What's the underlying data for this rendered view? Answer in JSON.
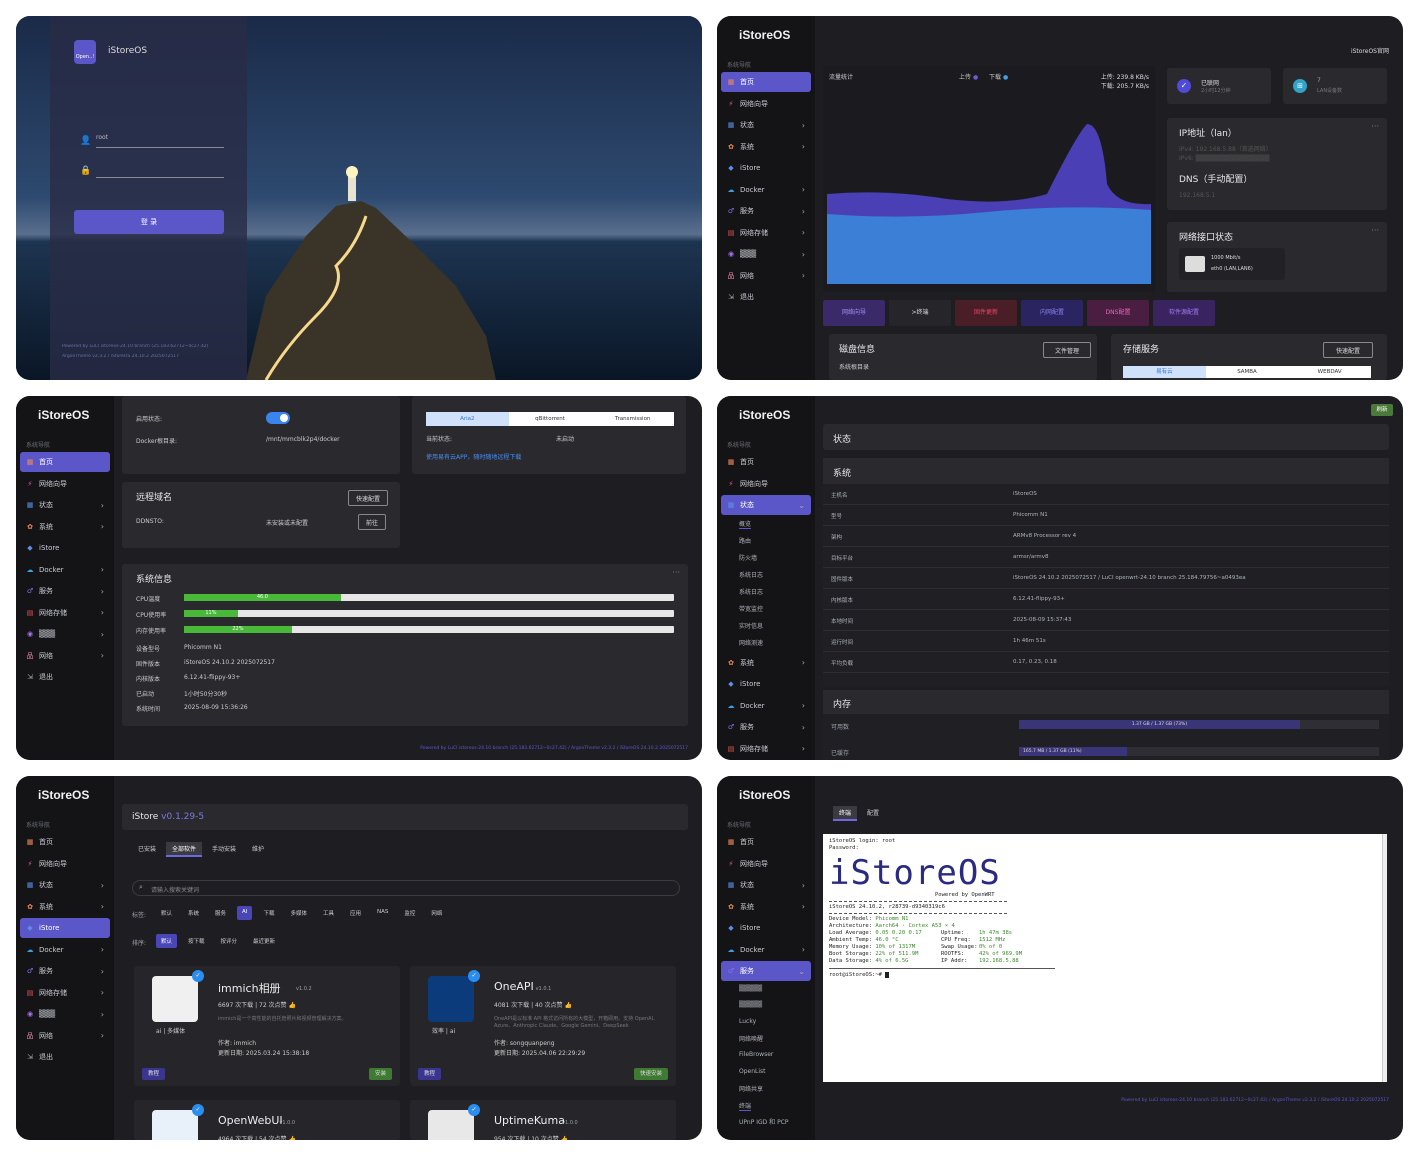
{
  "login": {
    "brand": "iStoreOS",
    "brand_badge": "Open..!",
    "username": "root",
    "login_button": "登 录",
    "footer_line1": "Powered by LuCI istoreos-24.10 branch (25.183.62712~0c27.42)",
    "footer_line2": "ArgonTheme v2.3.2 / iStoreOS 24.10.2 2025072517"
  },
  "sidebar": {
    "logo": "iStoreOS",
    "header": "系统导航",
    "items": [
      {
        "icon": "home-icon",
        "glyph": "▦",
        "label": "首页",
        "arrow": ""
      },
      {
        "icon": "wizard-icon",
        "glyph": "⚡",
        "label": "网络向导",
        "arrow": ""
      },
      {
        "icon": "status-icon",
        "glyph": "▦",
        "label": "状态",
        "arrow": "›"
      },
      {
        "icon": "system-icon",
        "glyph": "✿",
        "label": "系统",
        "arrow": "›"
      },
      {
        "icon": "istore-icon",
        "glyph": "◆",
        "label": "iStore",
        "arrow": ""
      },
      {
        "icon": "docker-icon",
        "glyph": "☁",
        "label": "Docker",
        "arrow": "›"
      },
      {
        "icon": "services-icon",
        "glyph": "♂",
        "label": "服务",
        "arrow": "›"
      },
      {
        "icon": "storage-icon",
        "glyph": "▤",
        "label": "网络存储",
        "arrow": "›"
      },
      {
        "icon": "vpn-icon",
        "glyph": "◉",
        "label": "▒▒▒",
        "arrow": "›"
      },
      {
        "icon": "network-icon",
        "glyph": "品",
        "label": "网络",
        "arrow": "›"
      },
      {
        "icon": "logout-icon",
        "glyph": "⇲",
        "label": "退出",
        "arrow": ""
      }
    ]
  },
  "home": {
    "top_link": "iStoreOS官网",
    "traffic_title": "流量统计",
    "legend_up": "上传",
    "legend_down": "下载",
    "rate_up": "上传: 239.8 KB/s",
    "rate_down": "下载: 205.7 KB/s",
    "connected": "已联网",
    "connected_sub": "2小时12分钟",
    "devices_count": "7",
    "devices_sub": "LAN设备数",
    "ip_title": "IP地址（lan）",
    "ipv4": "IPv4: 192.168.5.88（首选网络）",
    "ipv6": "IPv6: ▒▒▒▒▒▒▒▒▒▒▒▒▒▒▒▒",
    "dns_title": "DNS（手动配置）",
    "dns_value": "192.168.5.1",
    "netif_title": "网络接口状态",
    "netif_speed": "1000 Mbit/s",
    "netif_name": "eth0 (LAN,LAN6)",
    "actions": [
      "网络向导",
      ">终端",
      "固件更新",
      "内网配置",
      "DNS配置",
      "软件源配置"
    ],
    "disk_title": "磁盘信息",
    "disk_btn": "文件管理",
    "disk_sub": "系统根目录",
    "storage_title": "存储服务",
    "storage_btn": "快速配置",
    "storage_tabs": [
      "易有云",
      "SAMBA",
      "WEBDAV"
    ]
  },
  "home2": {
    "enable_label": "启用状态:",
    "docker_dir_label": "Docker根目录:",
    "docker_dir": "/mnt/mmcblk2p4/docker",
    "dl_tabs": [
      "Aria2",
      "qBittorrent",
      "Transmission"
    ],
    "dl_status_label": "当前状态:",
    "dl_status": "未启动",
    "dl_link": "使用易有云APP，随时随地远程下载",
    "ddns_title": "远程域名",
    "ddns_btn": "快速配置",
    "ddns_label": "DDNSTO:",
    "ddns_value": "未安装或未配置",
    "ddns_goto": "前往",
    "sys_title": "系统信息",
    "cpu_label": "CPU温度",
    "cpu_pct": "46.0",
    "cpu_use_label": "CPU使用率",
    "cpu_use": "11%",
    "mem_label": "内存使用率",
    "mem_pct": "22%",
    "model_label": "设备型号",
    "model": "Phicomm N1",
    "fw_label": "固件版本",
    "fw": "iStoreOS 24.10.2 2025072517",
    "kernel_label": "内核版本",
    "kernel": "6.12.41-flippy-93+",
    "uptime_label": "已启动",
    "uptime": "1小时50分30秒",
    "time_label": "系统时间",
    "time": "2025-08-09 15:36:26",
    "footer": "Powered by LuCI istoreos-24.10 branch (25.183.62712~0c27.42) / ArgonTheme v2.3.2 / iStoreOS 24.10.2 2025072517"
  },
  "status": {
    "refresh": "刷新",
    "title": "状态",
    "sys_section": "系统",
    "submenu": [
      "概览",
      "路由",
      "防火墙",
      "系统日志",
      "系统日志",
      "带宽监控",
      "实时信息",
      "网络测速"
    ],
    "rows": [
      [
        "主机名",
        "iStoreOS"
      ],
      [
        "型号",
        "Phicomm N1"
      ],
      [
        "架构",
        "ARMv8 Processor rev 4"
      ],
      [
        "目标平台",
        "armsr/armv8"
      ],
      [
        "固件版本",
        "iStoreOS 24.10.2 2025072517 / LuCI openwrt-24.10 branch 25.184.79756~a0493ea"
      ],
      [
        "内核版本",
        "6.12.41-flippy-93+"
      ],
      [
        "本地时间",
        "2025-08-09 15:37:43"
      ],
      [
        "运行时间",
        "1h 46m 51s"
      ],
      [
        "平均负载",
        "0.17, 0.23, 0.18"
      ]
    ],
    "mem_section": "内存",
    "mem_avail_label": "可用数",
    "mem_avail": "1.37 GB / 1.37 GB (73%)",
    "mem_used_label": "已缓存",
    "mem_used": "165.7 MB / 1.37 GB (11%)"
  },
  "istore": {
    "title": "iStore",
    "version": "v0.1.29-5",
    "tabs": [
      "已安装",
      "全部软件",
      "手动安装",
      "维护"
    ],
    "search_placeholder": "请输入搜索关键词",
    "cat_label": "标签:",
    "cats": [
      "默认",
      "系统",
      "服务",
      "AI",
      "下载",
      "多媒体",
      "工具",
      "应用",
      "NAS",
      "监控",
      "网络"
    ],
    "sort_label": "排序:",
    "sorts": [
      "默认",
      "按下载",
      "按评分",
      "最近更新"
    ],
    "apps": [
      {
        "name": "immich相册",
        "ver": "v1.0.2",
        "stats": "6697 次下载 | 72 次点赞 👍",
        "desc": "immich是一个高性能的自托管照片和视频管理解决方案。",
        "author": "作者: immich",
        "date": "更新日期: 2025.03.24 15:38:18",
        "tags": "ai | 多媒体",
        "left_btn": "教程",
        "right_btn": "安装"
      },
      {
        "name": "OneAPI",
        "ver": "v1.0.1",
        "stats": "4081 次下载 | 40 次点赞 👍",
        "desc": "OneAPI是以标准 API 格式访问所有的大模型，开箱即用。支持 OpenAI、Azure、Anthropic Claude、Google Gemini、DeepSeek",
        "author": "作者: songquanpeng",
        "date": "更新日期: 2025.04.06 22:29:29",
        "tags": "效率 | ai",
        "left_btn": "教程",
        "right_btn": "快速安装"
      },
      {
        "name": "OpenWebUI",
        "ver": "v1.0.0",
        "stats": "4964 次下载 | 54 次点赞 👍",
        "desc": "",
        "author": "",
        "date": "",
        "tags": "",
        "left_btn": "",
        "right_btn": ""
      },
      {
        "name": "UptimeKuma",
        "ver": "v1.0.0",
        "stats": "954 次下载 | 10 次点赞 👍",
        "desc": "",
        "author": "",
        "date": "",
        "tags": "",
        "left_btn": "",
        "right_btn": ""
      }
    ]
  },
  "terminal": {
    "tabs": [
      "终端",
      "配置"
    ],
    "lines": [
      "iStoreOS login: root",
      "Password:"
    ],
    "banner": "iStoreOS",
    "banner_sub": "Powered by OpenWRT",
    "version_line": "iStoreOS 24.10.2, r28739-d9340319c6",
    "info": [
      [
        "Device Model:",
        "Phicomm N1",
        "",
        ""
      ],
      [
        "Architecture:",
        "Aarch64 · Cortex A53 × 4",
        "",
        ""
      ],
      [
        "Load Average:",
        "0.05 0.20 0.17",
        "Uptime:",
        "1h 47m 38s"
      ],
      [
        "Ambient Temp:",
        "46.0 °C",
        "CPU Freq:",
        "1512 MHz"
      ],
      [
        "Memory Usage:",
        "10% of 1317M",
        "Swap Usage:",
        "0% of 0"
      ],
      [
        "Boot Storage:",
        "22% of 511.9M",
        "ROOTFS:",
        "42% of 969.9M"
      ],
      [
        "Data Storage:",
        "4% of 6.5G",
        "IP Addr:",
        "192.168.5.88"
      ]
    ],
    "prompt": "root@iStoreOS:~# ",
    "submenu": [
      "▒▒▒▒▒",
      "▒▒▒▒▒",
      "Lucky",
      "网络唤醒",
      "FileBrowser",
      "OpenList",
      "网络共享",
      "终端",
      "UPnP IGD 和 PCP"
    ],
    "footer": "Powered by LuCI istoreos-24.10 branch (25.183.62712~0c27.42) / ArgonTheme v2.3.2 / iStoreOS 24.10.2 2025072517"
  },
  "colors": {
    "accent": "#5b57c9",
    "green": "#49b93a",
    "bg": "#1e1e22",
    "card": "#2a2a2e",
    "sidebar": "#141416"
  }
}
